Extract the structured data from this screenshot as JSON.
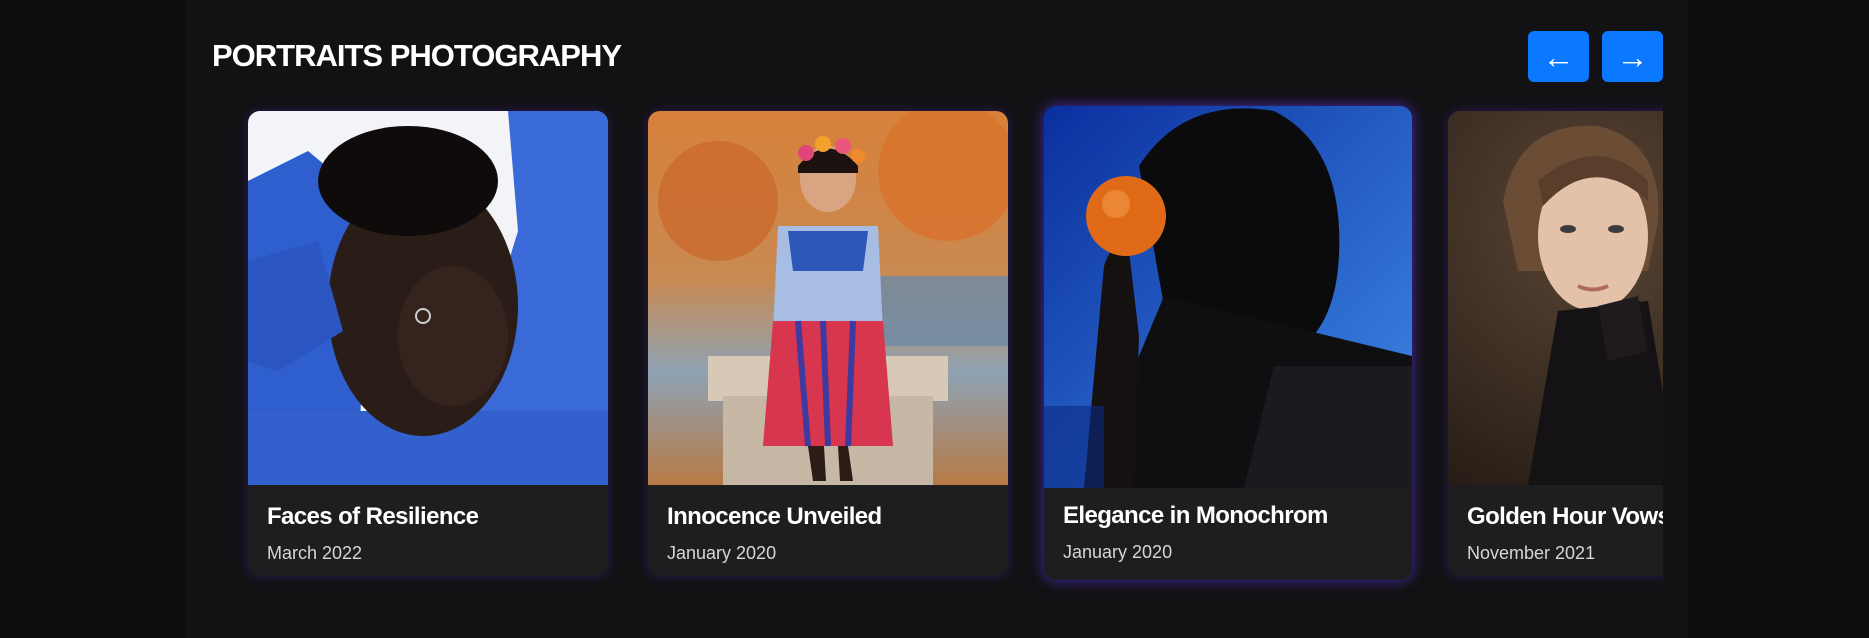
{
  "gallery": {
    "title": "PORTRAITS PHOTOGRAPHY",
    "prev_icon": "←",
    "next_icon": "→",
    "cards": [
      {
        "title": "Faces of Resilience",
        "date": "March 2022"
      },
      {
        "title": "Innocence Unveiled",
        "date": "January 2020"
      },
      {
        "title": "Elegance in Monochrom",
        "date": "January 2020"
      },
      {
        "title": "Golden Hour Vows",
        "date": "November 2021"
      }
    ]
  },
  "colors": {
    "accent": "#0a78ff",
    "card_background": "#1e1e20",
    "active_glow": "#5a32dc"
  }
}
